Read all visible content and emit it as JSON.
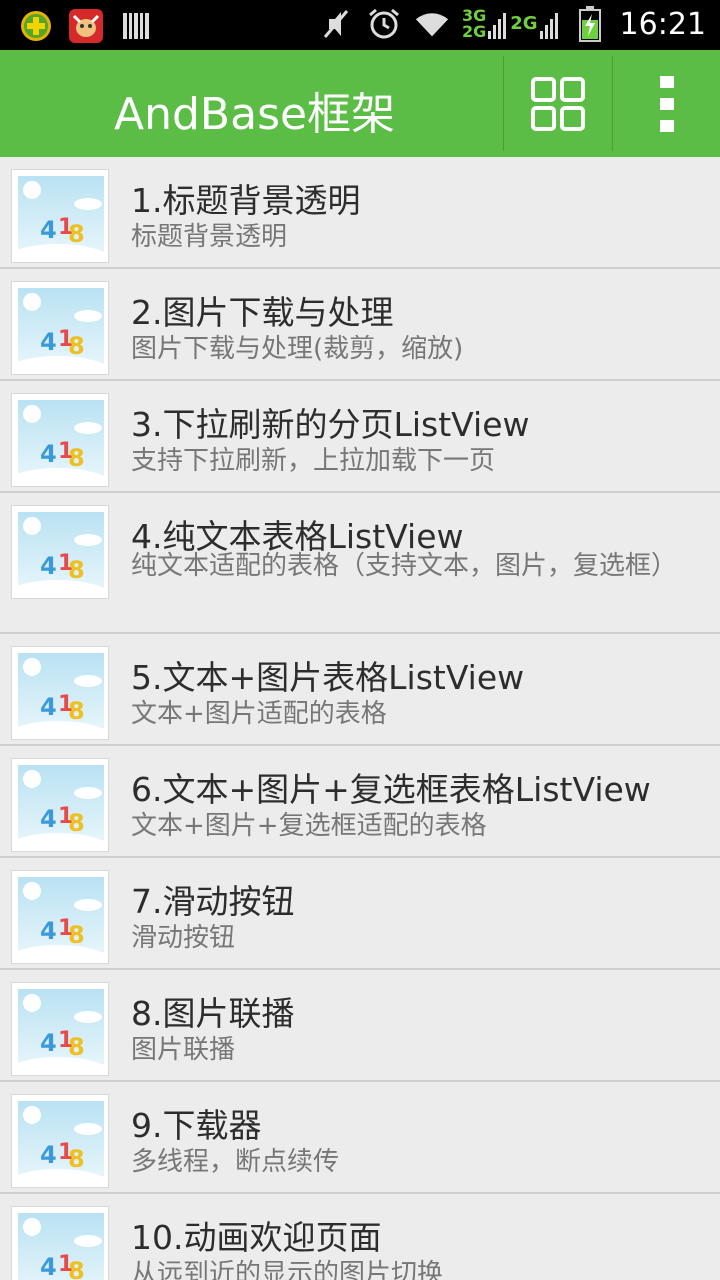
{
  "status_bar": {
    "time": "16:21",
    "net_3g": "3G",
    "net_2g_a": "2G",
    "net_2g_b": "2G"
  },
  "action_bar": {
    "title": "AndBase框架"
  },
  "items": [
    {
      "title": "1.标题背景透明",
      "subtitle": "标题背景透明"
    },
    {
      "title": "2.图片下载与处理",
      "subtitle": "图片下载与处理(裁剪，缩放)"
    },
    {
      "title": "3.下拉刷新的分页ListView",
      "subtitle": "支持下拉刷新，上拉加载下一页"
    },
    {
      "title": "4.纯文本表格ListView",
      "subtitle": "纯文本适配的表格（支持文本，图片，复选框）"
    },
    {
      "title": "5.文本+图片表格ListView",
      "subtitle": "文本+图片适配的表格"
    },
    {
      "title": "6.文本+图片+复选框表格ListView",
      "subtitle": "文本+图片+复选框适配的表格"
    },
    {
      "title": "7.滑动按钮",
      "subtitle": "滑动按钮"
    },
    {
      "title": "8.图片联播",
      "subtitle": "图片联播"
    },
    {
      "title": "9.下载器",
      "subtitle": "多线程，断点续传"
    },
    {
      "title": "10.动画欢迎页面",
      "subtitle": "从远到近的显示的图片切换"
    }
  ],
  "colors": {
    "accent": "#5bbd45",
    "status_bar": "#000000"
  }
}
